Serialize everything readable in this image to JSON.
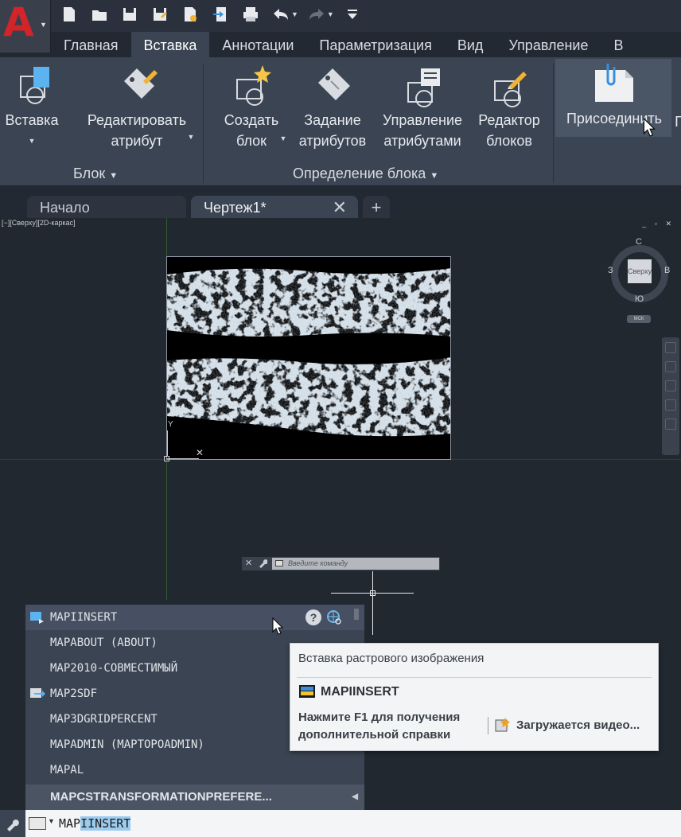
{
  "app": {
    "logo_letter": "A"
  },
  "qat": {
    "icons": [
      "new-icon",
      "open-icon",
      "save-icon",
      "save-as-icon",
      "publish-icon",
      "import-icon",
      "print-icon",
      "undo-icon",
      "redo-icon",
      "customize-icon"
    ]
  },
  "ribbon": {
    "tabs": [
      "Главная",
      "Вставка",
      "Аннотации",
      "Параметризация",
      "Вид",
      "Управление",
      "В"
    ],
    "active_tab": "Вставка",
    "insert_label": "Вставка",
    "edit_attr_line1": "Редактировать",
    "edit_attr_line2": "атрибут",
    "create_block_line1": "Создать",
    "create_block_line2": "блок",
    "define_attr_line1": "Задание",
    "define_attr_line2": "атрибутов",
    "manage_attr_line1": "Управление",
    "manage_attr_line2": "атрибутами",
    "block_editor_line1": "Редактор",
    "block_editor_line2": "блоков",
    "attach_label": "Присоединить",
    "next_label": "Г",
    "panel_block": "Блок",
    "panel_block_def": "Определение блока"
  },
  "file_tabs": {
    "start": "Начало",
    "drawing": "Чертеж1*",
    "close_glyph": "✕",
    "new_glyph": "+"
  },
  "viewport": {
    "label": "[−][Сверху][2D-каркас]",
    "controls": "_ ▫ ✕"
  },
  "viewcube": {
    "n": "С",
    "s": "Ю",
    "w": "З",
    "e": "В",
    "face": "Сверху",
    "wcs": "МСК"
  },
  "ucs": {
    "y": "Y",
    "x": "✕"
  },
  "float_cmd": {
    "placeholder": "Введите команду",
    "close": "✕"
  },
  "autocomplete": {
    "items": [
      "MAPIINSERT",
      "MAPABOUT (ABOUT)",
      "MAP2010-СОВМЕСТИМЫЙ",
      "MAP2SDF",
      "MAP3DGRIDPERCENT",
      "MAPADMIN (MAPTOPOADMIN)",
      "MAPAL",
      "MAPCSTRANSFORMATIONPREFERE..."
    ],
    "help_glyph": "?"
  },
  "tooltip": {
    "title": "Вставка растрового изображения",
    "command": "MAPIINSERT",
    "help_line1": "Нажмите F1 для получения",
    "help_line2": "дополнительной справки",
    "video": "Загружается видео..."
  },
  "command_line": {
    "typed": "MAP",
    "completion": "IINSERT"
  },
  "colors": {
    "accent": "#d3242a",
    "ribbon": "#3b4452",
    "canvas": "#212830",
    "highlight": "#9ccbf0"
  }
}
